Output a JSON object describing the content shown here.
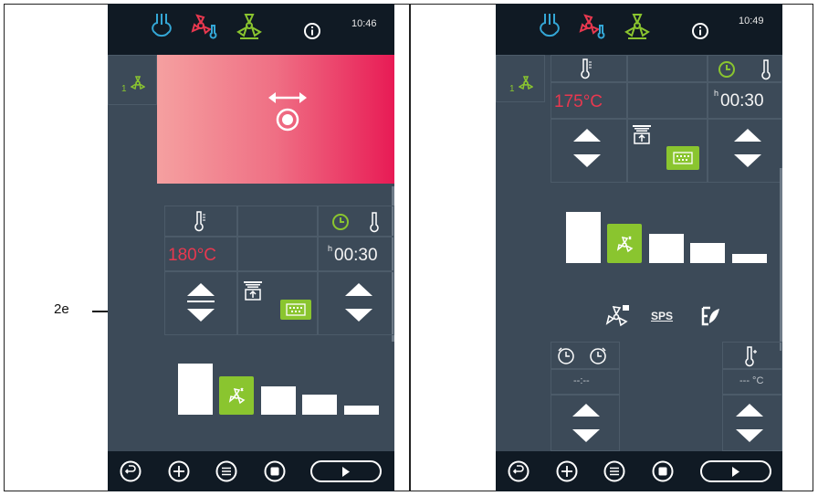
{
  "left_screen": {
    "time": "10:46",
    "top_icons": [
      "steam-icon",
      "combi-icon",
      "convection-fan-icon",
      "info-icon"
    ],
    "fan_level": "1",
    "temperature": "180°C",
    "timer": "00:30",
    "timer_unit": "h",
    "stages_count": 5,
    "bottom_icons": [
      "back-icon",
      "add-icon",
      "menu-icon",
      "stop-icon",
      "play-icon"
    ]
  },
  "right_screen": {
    "time": "10:49",
    "top_icons": [
      "steam-icon",
      "combi-icon",
      "convection-fan-icon",
      "info-icon"
    ],
    "fan_level": "1",
    "temperature": "175°C",
    "timer": "00:30",
    "timer_unit": "h",
    "sps_label": "SPS",
    "delay_value": "--:--",
    "core_temp_value": "--- °C",
    "bottom_icons": [
      "back-icon",
      "add-icon",
      "menu-icon",
      "stop-icon",
      "play-icon"
    ]
  },
  "callout": {
    "label": "2e"
  },
  "colors": {
    "screen_bg": "#3c4a58",
    "bar_bg": "#101a24",
    "accent_green": "#8ac52f",
    "temp_red": "#e8384f",
    "steam_blue": "#34a7d6"
  }
}
